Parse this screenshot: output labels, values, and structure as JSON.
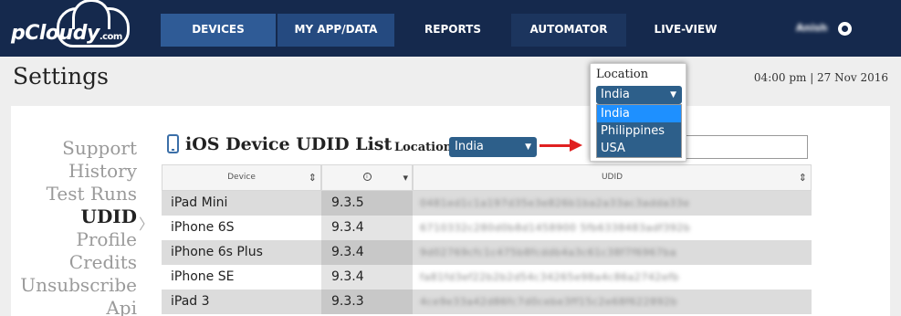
{
  "nav": {
    "logo_text": "pCloudy",
    "logo_suffix": ".com",
    "items": [
      "DEVICES",
      "MY APP/DATA",
      "REPORTS",
      "AUTOMATOR",
      "LIVE-VIEW"
    ],
    "user_name": "Anish"
  },
  "header": {
    "title": "Settings",
    "datetime": "04:00 pm | 27 Nov 2016"
  },
  "sidebar": {
    "items": [
      "Support",
      "History",
      "Test Runs",
      "UDID",
      "Profile",
      "Credits",
      "Unsubscribe",
      "Api"
    ],
    "active": "UDID"
  },
  "content": {
    "title": "iOS Device UDID List",
    "location_label": "Location",
    "location_value": "India"
  },
  "table": {
    "headers": [
      "Device",
      "",
      "UDID"
    ],
    "rows": [
      {
        "device": "iPad Mini",
        "version": "9.3.5",
        "udid": "0481ed1c1a197d35e3e826b1ba2a33ac3adda33e"
      },
      {
        "device": "iPhone 6S",
        "version": "9.3.4",
        "udid": "6710332c280d0b8d1458900 5fb6338483adf392b"
      },
      {
        "device": "iPhone 6s Plus",
        "version": "9.3.4",
        "udid": "9d02769cfc1c475b8fcddb4a3c61c38f7f6967ba"
      },
      {
        "device": "iPhone SE",
        "version": "9.3.4",
        "udid": "fa81fd3ef22b2b2d54c34265e98a4c86a2742efb"
      },
      {
        "device": "iPad 3",
        "version": "9.3.3",
        "udid": "4ce9e33a42d86fc7d0cebe3ff15c2e68f622892b"
      }
    ]
  },
  "popover": {
    "label": "Location",
    "selected": "India",
    "options": [
      "India",
      "Philippines",
      "USA"
    ]
  },
  "colors": {
    "nav_bg": "#15294d",
    "select_bg": "#2d5f8a",
    "option_highlight": "#1e90ff",
    "arrow": "#e02020"
  }
}
